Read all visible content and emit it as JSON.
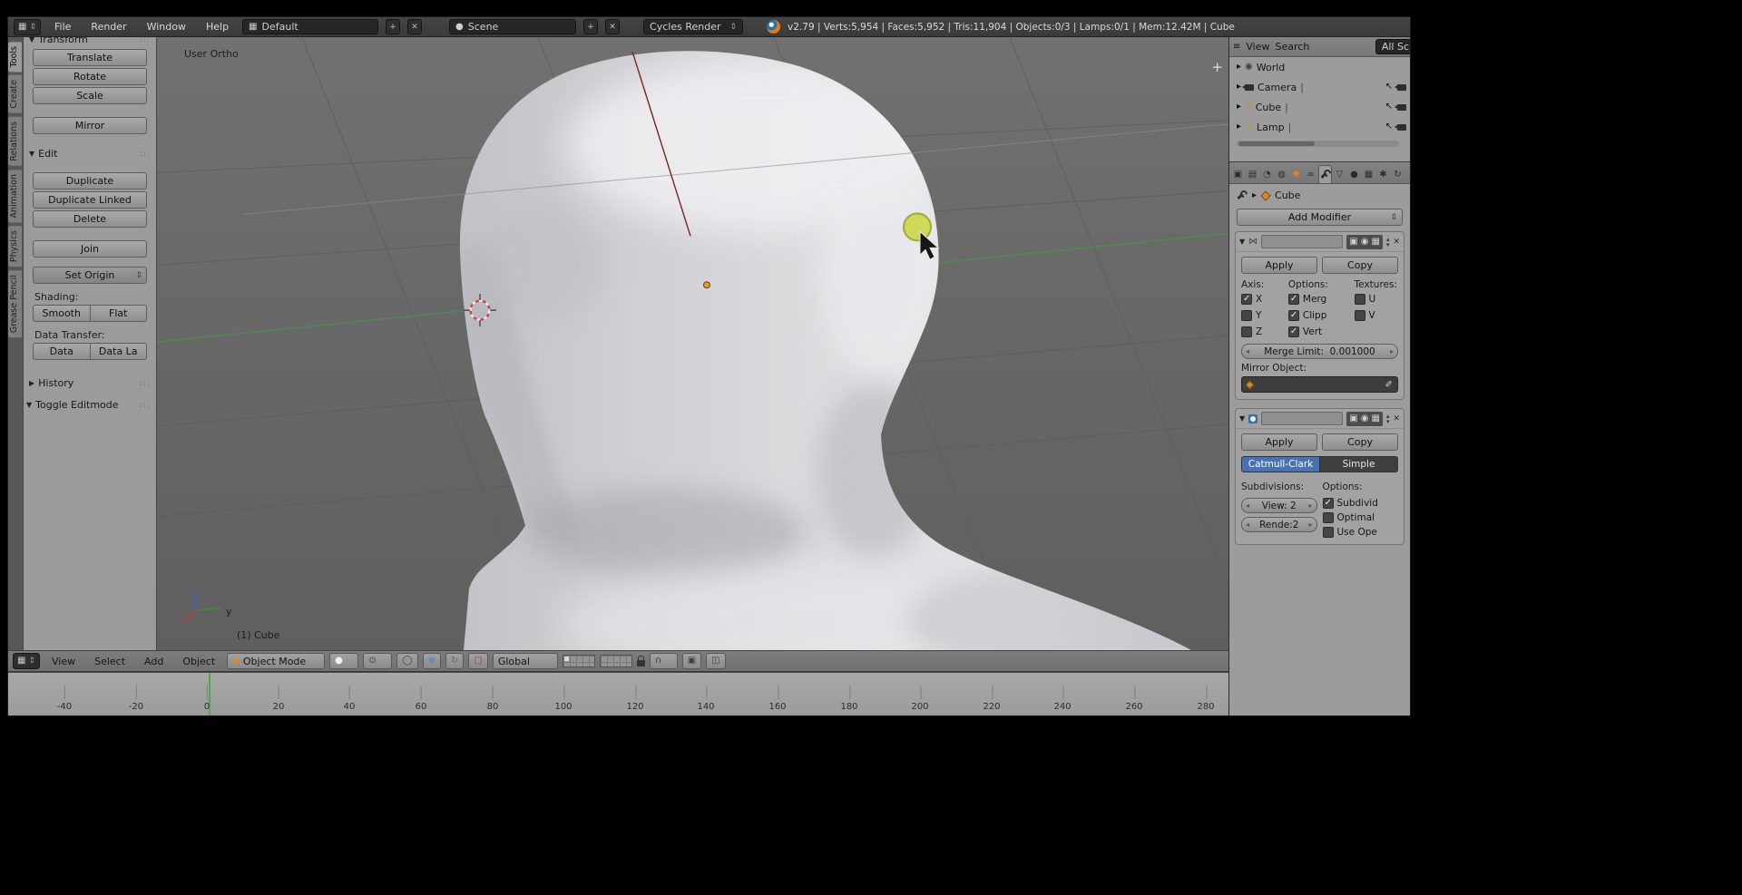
{
  "icons": {
    "updown": "⇕",
    "plus": "+",
    "close": "✕",
    "tri_down": "▼",
    "tri_right": "▶",
    "tri_small": "▸",
    "tri_up_small": "▴",
    "tri_down_small": "▾",
    "arrow_left_small": "◂",
    "arrow_right_small": "▸",
    "grip": ":::",
    "grid": "▦",
    "list": "≡",
    "pipe": "|",
    "sphere_white": "●",
    "pivot": "⊙",
    "prop_edit": "◯",
    "manip_translate": "⊕",
    "manip_rotate": "↻",
    "manip_scale": "▢",
    "magnet": "∩",
    "render_still": "▣",
    "render_anim": "◫",
    "mirror_mod": "⋈",
    "object_diamond": "◆",
    "eyedropper": "✐",
    "world": "◉",
    "mesh_tri": "▽",
    "lamp": "☀",
    "select_arrow": "↖",
    "toggle_a": "▣",
    "toggle_b": "◉",
    "toggle_c": "▦"
  },
  "top_bar": {
    "menus": [
      "File",
      "Render",
      "Window",
      "Help"
    ],
    "layout": "Default",
    "scene": "Scene",
    "engine": "Cycles Render",
    "stats": "v2.79 | Verts:5,954 | Faces:5,952 | Tris:11,904 | Objects:0/3 | Lamps:0/1 | Mem:12.42M | Cube"
  },
  "tool_tabs": [
    "Tools",
    "Create",
    "Relations",
    "Animation",
    "Physics",
    "Grease Pencil"
  ],
  "tool_shelf": {
    "transform_title": "Transform",
    "translate": "Translate",
    "rotate": "Rotate",
    "scale": "Scale",
    "mirror": "Mirror",
    "edit_title": "Edit",
    "duplicate": "Duplicate",
    "duplicate_linked": "Duplicate Linked",
    "delete": "Delete",
    "join": "Join",
    "set_origin": "Set Origin",
    "shading_label": "Shading:",
    "smooth": "Smooth",
    "flat": "Flat",
    "data_transfer_label": "Data Transfer:",
    "data": "Data",
    "data_la": "Data La",
    "history_title": "History",
    "toggle_editmode": "Toggle Editmode"
  },
  "viewport": {
    "view_label": "User Ortho",
    "object_info": "(1) Cube",
    "axis_y": "y"
  },
  "vp_header": {
    "view": "View",
    "select": "Select",
    "add": "Add",
    "object": "Object",
    "mode": "Object Mode",
    "orientation": "Global"
  },
  "timeline": {
    "ticks": [
      "-40",
      "-20",
      "0",
      "20",
      "40",
      "60",
      "80",
      "100",
      "120",
      "140",
      "160",
      "180",
      "200",
      "220",
      "240",
      "260",
      "280"
    ],
    "current_frame": "0"
  },
  "outliner": {
    "menu_view": "View",
    "menu_search": "Search",
    "display_mode": "All Sc",
    "items": [
      {
        "name": "World"
      },
      {
        "name": "Camera"
      },
      {
        "name": "Cube"
      },
      {
        "name": "Lamp"
      }
    ]
  },
  "props_tabs": [
    {
      "name": "render",
      "glyph": "▣"
    },
    {
      "name": "render-layers",
      "glyph": "▤"
    },
    {
      "name": "scene",
      "glyph": "◔"
    },
    {
      "name": "world",
      "glyph": "◍"
    },
    {
      "name": "object",
      "glyph": "◆"
    },
    {
      "name": "constraints",
      "glyph": "∞"
    },
    {
      "name": "modifiers",
      "glyph": ""
    },
    {
      "name": "object-data",
      "glyph": "▽"
    },
    {
      "name": "material",
      "glyph": "●"
    },
    {
      "name": "texture",
      "glyph": "▦"
    },
    {
      "name": "particles",
      "glyph": "✱"
    },
    {
      "name": "physics",
      "glyph": "↻"
    }
  ],
  "properties": {
    "context_object": "Cube",
    "add_modifier": "Add Modifier",
    "mirror": {
      "apply": "Apply",
      "copy": "Copy",
      "axis_label": "Axis:",
      "options_label": "Options:",
      "textures_label": "Textures:",
      "x": "X",
      "y": "Y",
      "z": "Z",
      "merge": "Merg",
      "clipping": "Clipp",
      "vertex": "Vert",
      "u": "U",
      "v": "V",
      "merge_limit_label": "Merge Limit:",
      "merge_limit_value": "0.001000",
      "mirror_object_label": "Mirror Object:"
    },
    "subsurf": {
      "apply": "Apply",
      "copy": "Copy",
      "catmull": "Catmull-Clark",
      "simple": "Simple",
      "subdivisions_label": "Subdivisions:",
      "options_label": "Options:",
      "view_label": "View:",
      "view_value": "2",
      "render_label": "Rende:",
      "render_value": "2",
      "subdivide": "Subdivid",
      "optimal": "Optimal",
      "use_open": "Use Ope"
    },
    "states": {
      "x": "true",
      "y": "false",
      "z": "false",
      "merge": "true",
      "clipping": "true",
      "vertex": "true",
      "u": "false",
      "v": "false",
      "subdivide": "true",
      "optimal": "false",
      "use_open": "false"
    }
  }
}
